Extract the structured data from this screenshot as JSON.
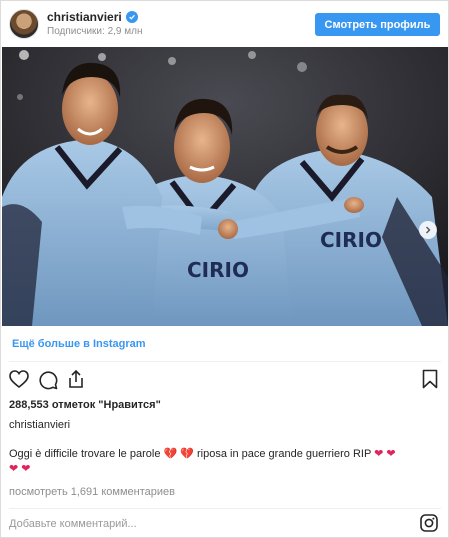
{
  "header": {
    "username": "christianvieri",
    "followers": "Подписчики: 2,9 млн",
    "profile_button": "Смотреть профиль"
  },
  "post": {
    "more_link": "Ещё больше в Instagram",
    "likes": "288,553 отметок \"Нравится\"",
    "author": "christianvieri",
    "caption_part1": "Oggi è difficile trovare le parole",
    "caption_hearts1": "💔 💔",
    "caption_part2": "riposa in pace grande guerriero RIP",
    "caption_hearts2": "❤ ❤",
    "caption_hearts3": "❤ ❤",
    "comments_link": "посмотреть 1,691 комментариев",
    "comment_placeholder": "Добавьте комментарий..."
  },
  "colors": {
    "accent": "#3897f0",
    "text": "#262626",
    "muted": "#8e8e8e",
    "border": "#dbdbdb"
  },
  "icons": [
    "verified-badge-icon",
    "chevron-right-icon",
    "heart-icon",
    "comment-icon",
    "share-icon",
    "bookmark-icon",
    "instagram-logo-icon"
  ]
}
